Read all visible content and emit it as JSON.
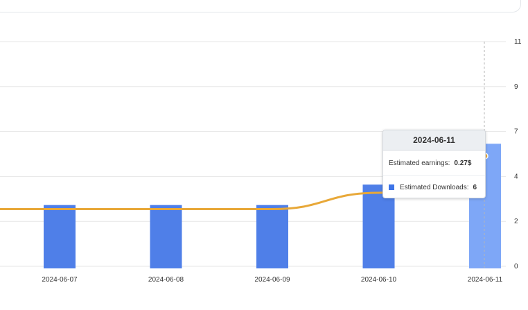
{
  "chart_data": {
    "type": "bar",
    "categories": [
      "2024-06-07",
      "2024-06-08",
      "2024-06-09",
      "2024-06-10",
      "2024-06-11"
    ],
    "series": [
      {
        "name": "Estimated Downloads",
        "type": "bar",
        "values": [
          3,
          3,
          3,
          4,
          6
        ],
        "color": "#4f7fe8",
        "highlight_color": "#7ea7f7"
      },
      {
        "name": "Estimated earnings",
        "type": "line",
        "values": [
          2.8,
          2.8,
          2.8,
          3.6,
          5.4
        ],
        "color": "#e8a838"
      }
    ],
    "y_ticks": [
      "0",
      "2",
      "4",
      "7",
      "9",
      "11"
    ],
    "ylim": [
      0,
      11
    ],
    "grid": true,
    "highlighted_category": "2024-06-11"
  },
  "tooltip": {
    "title": "2024-06-11",
    "earnings_label": "Estimated earnings:",
    "earnings_value": "0.27$",
    "downloads_label": "Estimated Downloads:",
    "downloads_value": "6"
  },
  "colors": {
    "bar": "#4f7fe8",
    "bar_highlight": "#7ea7f7",
    "line": "#e8a838",
    "grid": "#e6e6e6"
  }
}
